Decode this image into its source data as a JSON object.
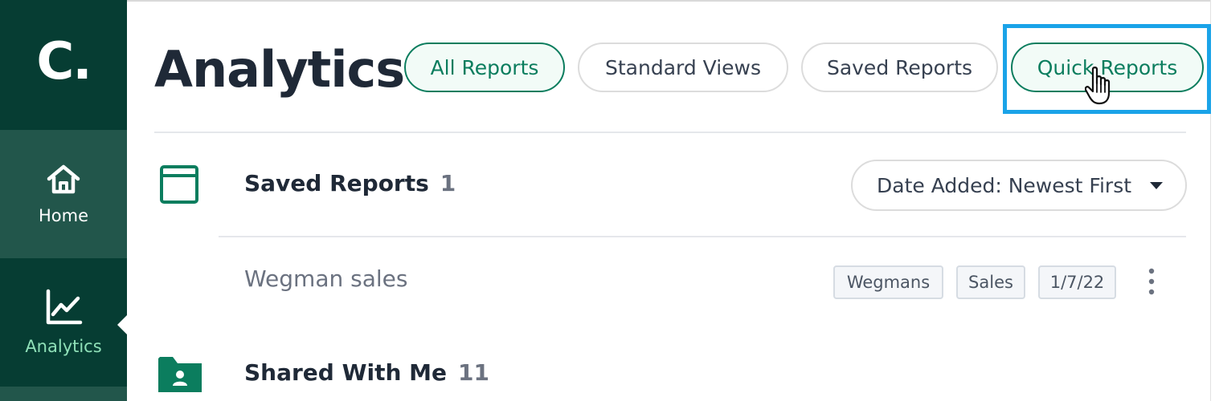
{
  "sidebar": {
    "logo": "C.",
    "items": [
      {
        "label": "Home",
        "icon": "home-icon"
      },
      {
        "label": "Analytics",
        "icon": "line-chart-icon"
      }
    ]
  },
  "header": {
    "title": "Analytics",
    "tabs": [
      {
        "label": "All Reports",
        "active": true
      },
      {
        "label": "Standard Views",
        "active": false
      },
      {
        "label": "Saved Reports",
        "active": false
      },
      {
        "label": "Quick Reports",
        "active": false
      }
    ]
  },
  "saved_reports": {
    "title": "Saved Reports",
    "count": "1",
    "sort_label": "Date Added: Newest First",
    "rows": [
      {
        "name": "Wegman sales",
        "tags": [
          "Wegmans",
          "Sales",
          "1/7/22"
        ]
      }
    ]
  },
  "shared": {
    "title": "Shared With Me",
    "count": "11"
  },
  "colors": {
    "sidebar_bg": "#063d33",
    "sidebar_active_bg": "#22564b",
    "accent": "#0b7d5e",
    "highlight": "#1aa3e8"
  }
}
